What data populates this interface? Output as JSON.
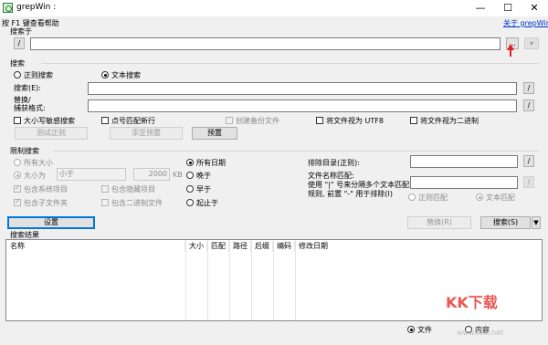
{
  "window": {
    "title": "grepWin :",
    "min": "—",
    "max": "☐",
    "close": "✕"
  },
  "help_hint": "按 F1 键查看帮助",
  "about_link": "关于 grepWin",
  "search_in": {
    "label": "搜索于",
    "path_value": "",
    "browse_label": "...",
    "dropdown_label": "▾"
  },
  "search": {
    "section_label": "搜索",
    "regex_radio": "正则搜索",
    "text_radio": "文本搜索",
    "search_label": "搜索(E):",
    "replace_label_1": "替换/",
    "replace_label_2": "捕获格式:",
    "search_value": "",
    "replace_value": "",
    "case_sensitive": "大小写敏感搜索",
    "dot_newline": "点号匹配新行",
    "create_backup": "创建备份文件",
    "treat_utf8": "将文件视为 UTF8",
    "treat_binary": "将文件视为二进制",
    "test_regex": "测试正则",
    "add_preset": "添至预置",
    "presets": "预置"
  },
  "limit": {
    "section_label": "限制搜索",
    "all_sizes": "所有大小",
    "size_is": "大小为",
    "size_op": "小于",
    "size_value": "2000",
    "size_unit": "KB",
    "include_system": "包含系统项目",
    "include_hidden": "包含隐藏项目",
    "include_subfolders": "包含子文件夹",
    "include_binary": "包含二进制文件",
    "all_dates": "所有日期",
    "newer": "晚于",
    "older": "早于",
    "between": "起止于",
    "exclude_dirs": "排除目录(正则):",
    "file_match_1": "文件名称匹配:",
    "file_match_2": "使用 \"|\" 号来分隔多个文本匹配",
    "file_match_3": "规则, 前置 \"-\" 用于排除(I)",
    "regex_match": "正则匹配",
    "text_match": "文本匹配"
  },
  "actions": {
    "settings": "设置",
    "replace": "替换(R)",
    "search": "搜索(S)"
  },
  "results": {
    "section_label": "搜索结果",
    "columns": [
      "名称",
      "大小",
      "匹配",
      "路径",
      "后缀",
      "编码",
      "修改日期"
    ],
    "show_files": "文件",
    "show_content": "内容"
  },
  "watermark": {
    "text": "KK下载",
    "url": "www.kkx.net"
  },
  "colors": {
    "accent": "#0078d7",
    "link": "#0033cc",
    "arrow": "#e02020"
  }
}
